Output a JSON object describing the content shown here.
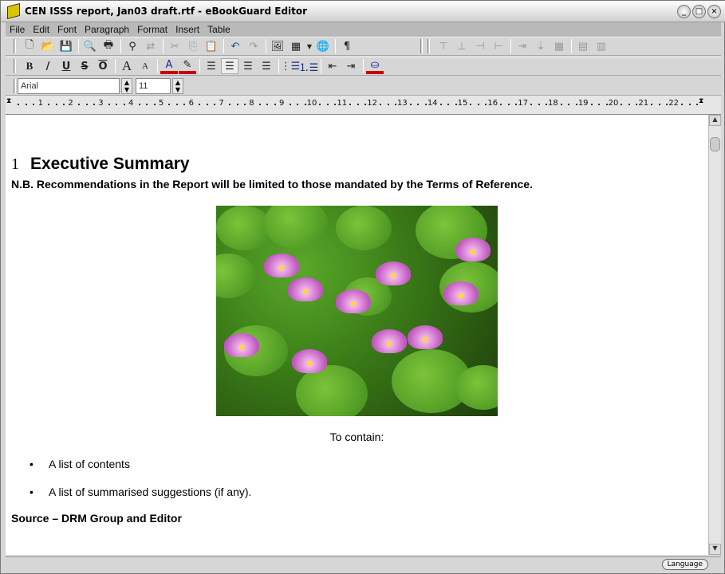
{
  "window": {
    "title": "CEN ISSS report, Jan03 draft.rtf - eBookGuard Editor"
  },
  "menu": [
    {
      "label": "File",
      "u": "F",
      "rest": "ile"
    },
    {
      "label": "Edit",
      "u": "E",
      "rest": "dit"
    },
    {
      "label": "Font",
      "u": "Fo",
      "rest": "n",
      "u2": "t"
    },
    {
      "label": "Paragraph",
      "u": "P",
      "rest": "aragraph"
    },
    {
      "label": "Format",
      "u": "Fo",
      "rest": "rmat"
    },
    {
      "label": "Insert",
      "u": "I",
      "rest": "nsert"
    },
    {
      "label": "Table",
      "u": "T",
      "rest": "able"
    }
  ],
  "font_bar": {
    "font": "Arial",
    "size": "11"
  },
  "ruler": {
    "marks": [
      "1",
      "2",
      "3",
      "4",
      "5",
      "6",
      "7",
      "8",
      "9",
      "10",
      "11",
      "12",
      "13",
      "14",
      "15",
      "16",
      "17",
      "18",
      "19",
      "20",
      "21",
      "22"
    ]
  },
  "document": {
    "heading_number": "1",
    "heading": "Executive Summary",
    "note": "N.B. Recommendations in the Report will be limited to those mandated by the Terms of Reference.",
    "image": "water lilies photo",
    "caption": "To contain:",
    "bullets": [
      "A list of contents",
      "A list of summarised suggestions (if any)."
    ],
    "source": "Source – DRM Group and Editor"
  },
  "status": {
    "language": "Language"
  },
  "colors": {
    "font_color": "#cc0000",
    "highlight": "#cc0000"
  }
}
